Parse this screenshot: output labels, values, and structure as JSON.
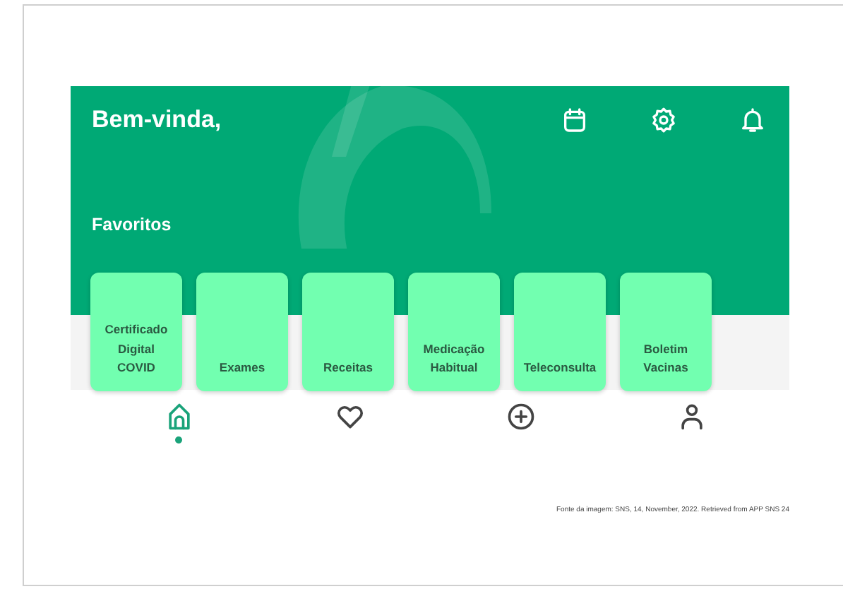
{
  "header": {
    "greeting": "Bem-vinda,",
    "actions": [
      {
        "kind": "calendar"
      },
      {
        "kind": "settings"
      },
      {
        "kind": "bell"
      }
    ]
  },
  "favorites": {
    "title": "Favoritos",
    "items": [
      {
        "label": "Certificado Digital COVID"
      },
      {
        "label": "Exames"
      },
      {
        "label": "Receitas"
      },
      {
        "label": "Medicação Habitual"
      },
      {
        "label": "Teleconsulta"
      },
      {
        "label": "Boletim Vacinas"
      }
    ]
  },
  "bottom_nav": [
    {
      "kind": "home",
      "selected": true
    },
    {
      "kind": "heart",
      "selected": false
    },
    {
      "kind": "plus",
      "selected": false
    },
    {
      "kind": "person",
      "selected": false
    }
  ],
  "caption": "Fonte da imagem: SNS, 14, November, 2022. Retrieved from APP SNS 24"
}
